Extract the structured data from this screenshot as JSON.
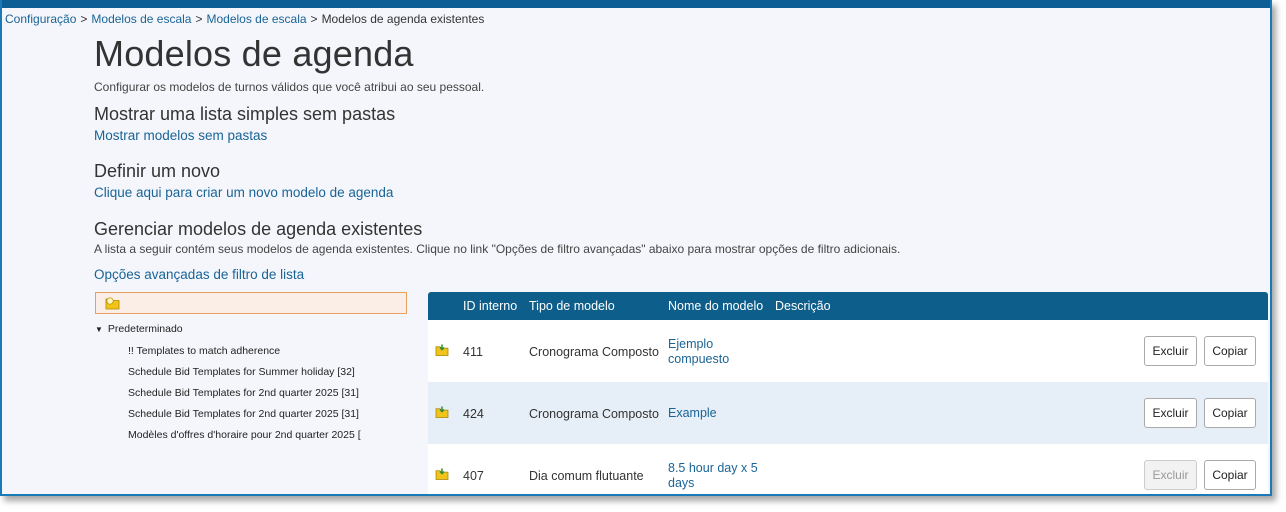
{
  "breadcrumb": [
    {
      "label": "Configuração",
      "link": true
    },
    {
      "label": "Modelos de escala",
      "link": true
    },
    {
      "label": "Modelos de escala",
      "link": true
    },
    {
      "label": "Modelos de agenda existentes",
      "link": false
    }
  ],
  "breadcrumb_separator": ">",
  "page": {
    "title": "Modelos de agenda",
    "subtitle": "Configurar os modelos de turnos válidos que você atribui ao seu pessoal."
  },
  "simple_list": {
    "heading": "Mostrar uma lista simples sem pastas",
    "link": "Mostrar modelos sem pastas"
  },
  "define_new": {
    "heading": "Definir um novo",
    "link": "Clique aqui para criar um novo modelo de agenda"
  },
  "manage": {
    "heading": "Gerenciar modelos de agenda existentes",
    "description": "A lista a seguir contém seus modelos de agenda existentes. Clique no link \"Opções de filtro avançadas\" abaixo para mostrar opções de filtro adicionais.",
    "advanced_filter_link": "Opções avançadas de filtro de lista"
  },
  "folder_tree": {
    "root": "Predeterminado",
    "children": [
      "!! Templates to match adherence",
      "Schedule Bid Templates for Summer holiday [32]",
      "Schedule Bid Templates for 2nd quarter 2025 [31]",
      "Schedule Bid Templates for 2nd quarter 2025 [31]",
      "Modèles d'offres d'horaire pour 2nd quarter 2025 ["
    ]
  },
  "table": {
    "headers": {
      "id": "ID interno",
      "type": "Tipo de modelo",
      "name": "Nome do modelo",
      "description": "Descrição"
    },
    "rows": [
      {
        "id": "411",
        "type": "Cronograma Composto",
        "name": "Ejemplo compuesto",
        "description": "",
        "delete_label": "Excluir",
        "copy_label": "Copiar",
        "delete_enabled": true
      },
      {
        "id": "424",
        "type": "Cronograma Composto",
        "name": "Example",
        "description": "",
        "delete_label": "Excluir",
        "copy_label": "Copiar",
        "delete_enabled": true
      },
      {
        "id": "407",
        "type": "Dia comum flutuante",
        "name": "8.5 hour day x 5 days",
        "description": "",
        "delete_label": "Excluir",
        "copy_label": "Copiar",
        "delete_enabled": false
      }
    ]
  },
  "icons": {
    "folder": "folder-icon",
    "template": "template-folder-icon",
    "tree_toggle": "triangle-down-icon"
  },
  "colors": {
    "accent": "#0e5e8c",
    "link": "#1a6496",
    "row_alt": "#e6eef7",
    "folder_box_bg": "#fbeee6",
    "folder_box_border": "#e8a060"
  }
}
